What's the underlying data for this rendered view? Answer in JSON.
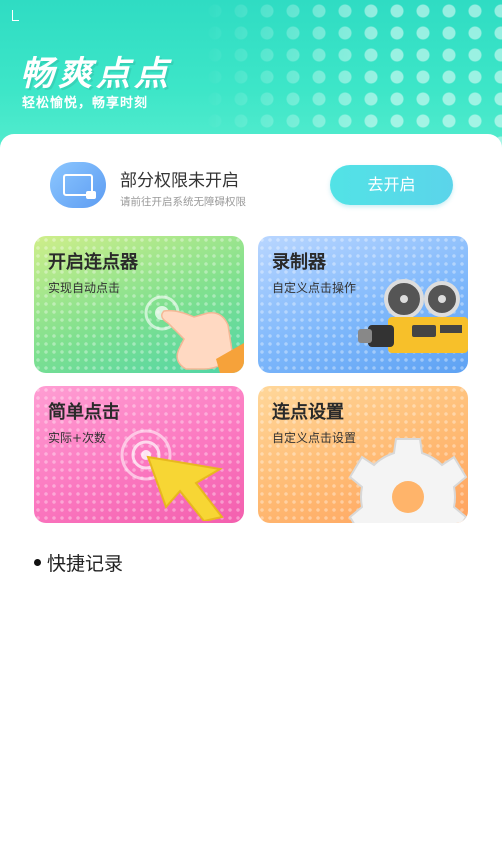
{
  "header": {
    "title": "畅爽点点",
    "subtitle": "轻松愉悦，畅享时刻"
  },
  "permission": {
    "title": "部分权限未开启",
    "desc": "请前往开启系统无障碍权限",
    "button": "去开启"
  },
  "tiles": [
    {
      "title": "开启连点器",
      "subtitle": "实现自动点击",
      "icon": "pointing-hand-icon",
      "color": "#7fe08f"
    },
    {
      "title": "录制器",
      "subtitle": "自定义点击操作",
      "icon": "film-camera-icon",
      "color": "#7fb8fb"
    },
    {
      "title": "简单点击",
      "subtitle": "实际+次数",
      "icon": "cursor-arrow-icon",
      "color": "#fb78c0"
    },
    {
      "title": "连点设置",
      "subtitle": "自定义点击设置",
      "icon": "gear-icon",
      "color": "#ffba73"
    }
  ],
  "section": {
    "title": "快捷记录"
  }
}
